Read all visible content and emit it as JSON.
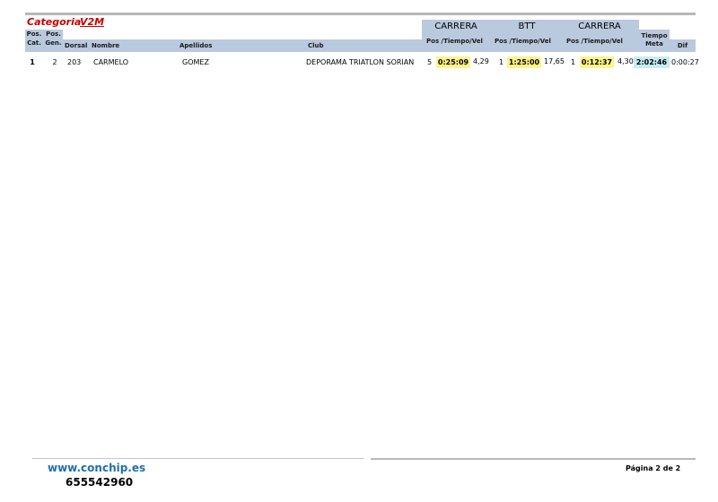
{
  "category": {
    "label": "Categoria",
    "value": "V2M"
  },
  "headers": {
    "pos_cat": [
      "Pos.",
      "Cat."
    ],
    "pos_gen": [
      "Pos.",
      "Gen."
    ],
    "dorsal": "Dorsal",
    "nombre": "Nombre",
    "apellidos": "Apellidos",
    "club": "Club",
    "segments": [
      {
        "title": "CARRERA",
        "sub": "Pos /Tiempo/Vel"
      },
      {
        "title": "BTT",
        "sub": "Pos /Tiempo/Vel"
      },
      {
        "title": "CARRERA",
        "sub": "Pos /Tiempo/Vel"
      }
    ],
    "tiempo_meta": [
      "Tiempo",
      "Meta"
    ],
    "dif": "Dif"
  },
  "rows": [
    {
      "pos_cat": "1",
      "pos_gen": "2",
      "dorsal": "203",
      "nombre": "CARMELO",
      "apellidos": "GOMEZ",
      "club": "DEPORAMA TRIATLON SORIAN",
      "seg1": {
        "pos": "5",
        "time": "0:25:09",
        "vel": "4,29"
      },
      "seg2": {
        "pos": "1",
        "time": "1:25:00",
        "vel": "17,65"
      },
      "seg3": {
        "pos": "1",
        "time": "0:12:37",
        "vel": "4,30"
      },
      "tiempo_meta": "2:02:46",
      "dif": "0:00:27"
    }
  ],
  "footer": {
    "website": "www.conchip.es",
    "phone": "655542960",
    "page": "Página 2 de 2"
  },
  "colors": {
    "category_red": "#cc0000",
    "header_blue": "#b9c9de",
    "time_yellow": "#fff38a",
    "meta_cyan": "#c6ecf5",
    "link_blue": "#1f6fb0"
  }
}
